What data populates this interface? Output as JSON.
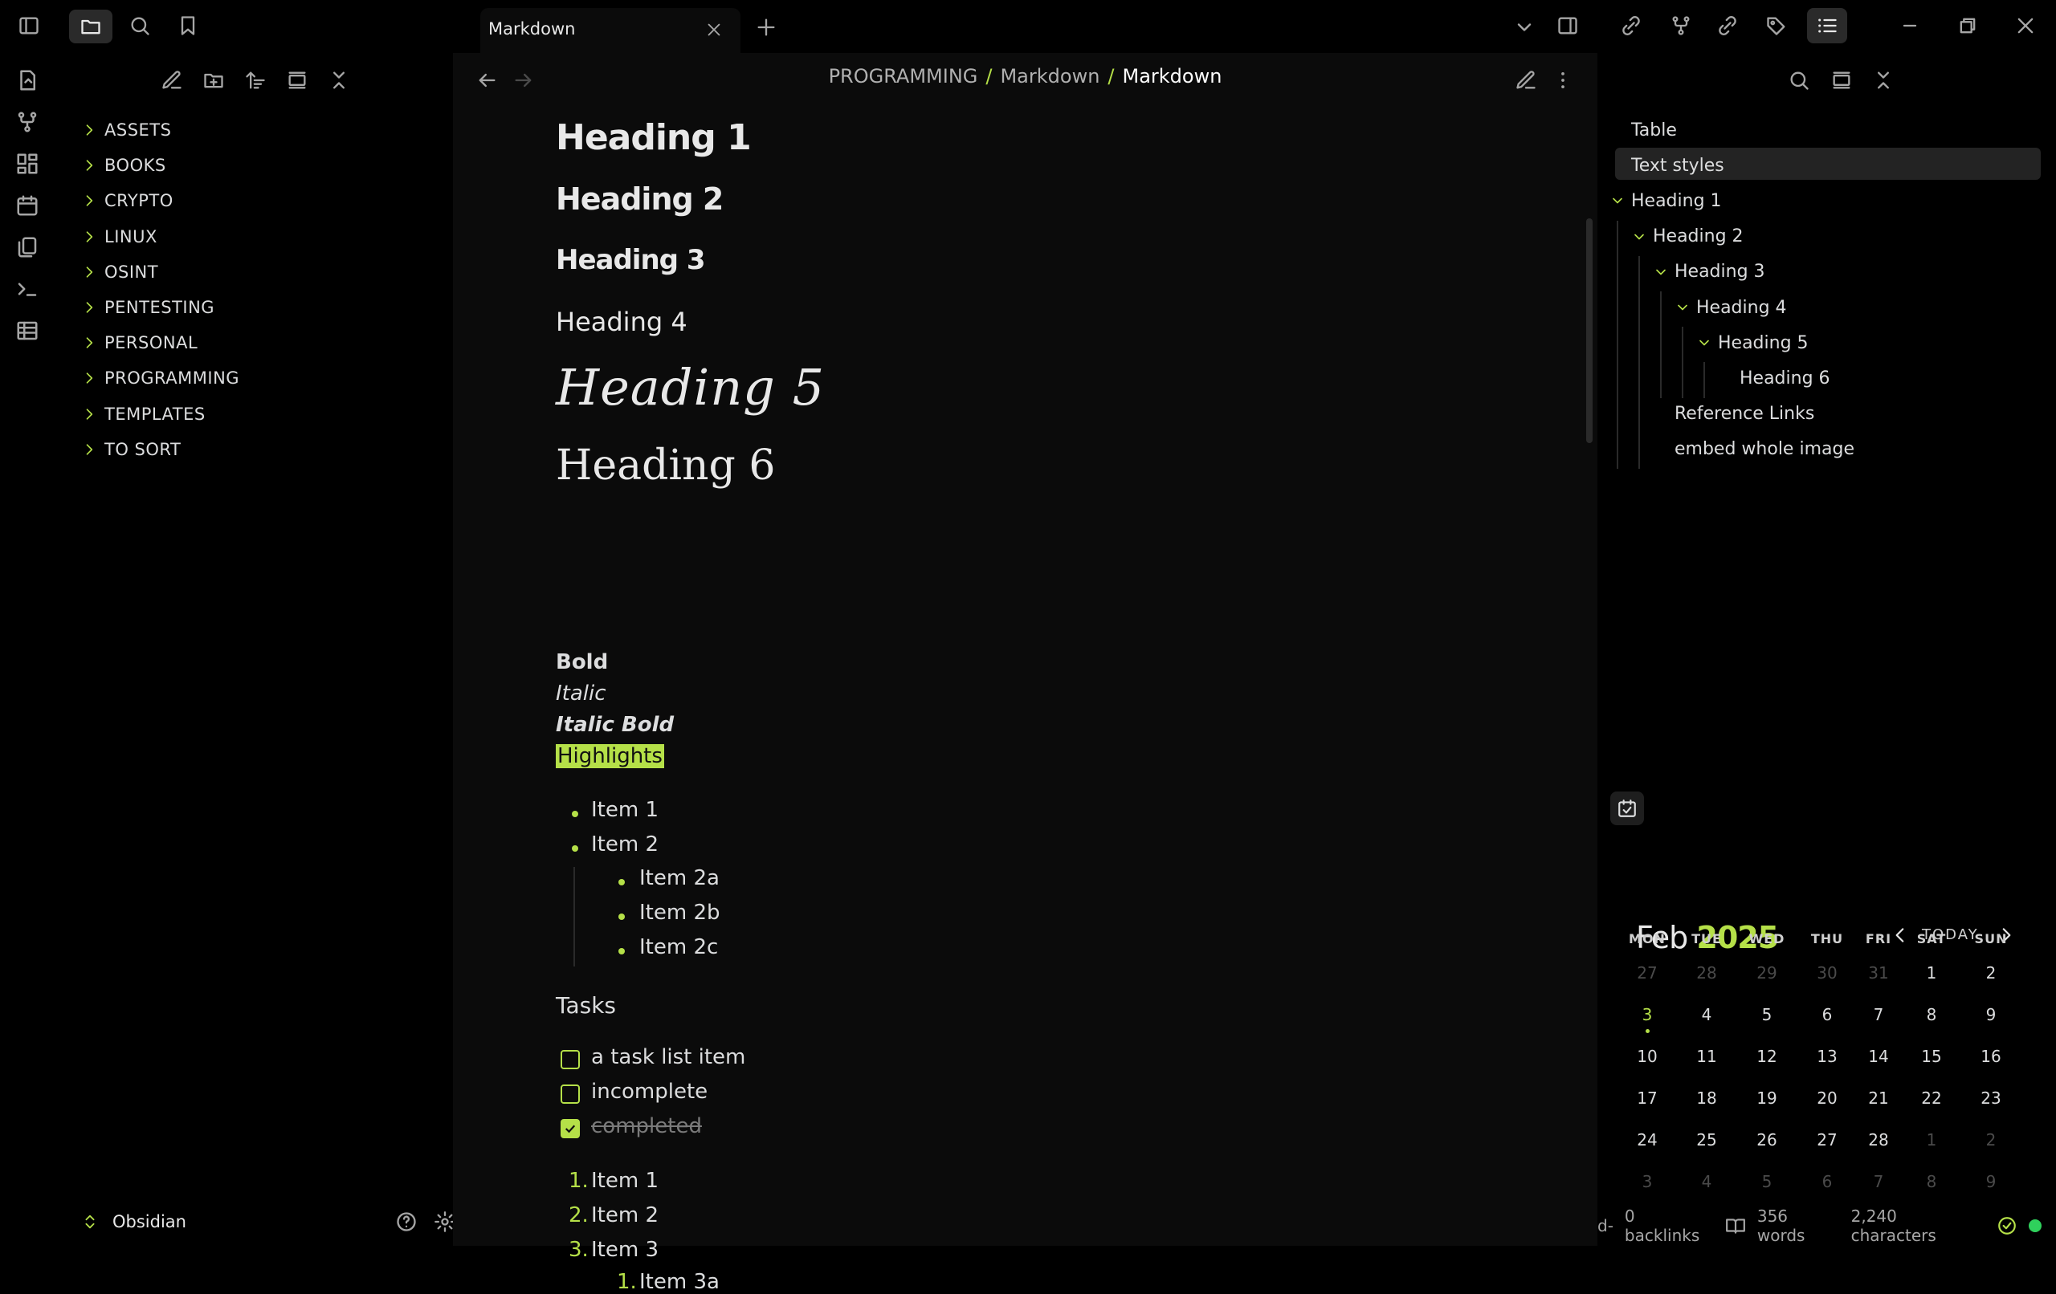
{
  "titlebar": {
    "tab_title": "Markdown",
    "new_tab_symbol": "+",
    "left_icons": [
      "sidebar-toggle-icon",
      "folder-icon",
      "search-icon",
      "bookmark-icon"
    ],
    "right_icons": [
      "chevron-down-icon",
      "right-sidebar-icon",
      "backlinks-icon",
      "graph-icon",
      "outgoing-links-icon",
      "tags-icon",
      "outline-icon",
      "minimize-icon",
      "restore-icon",
      "close-icon"
    ]
  },
  "ribbon": [
    "open-quick-switcher-icon",
    "graph-view-icon",
    "canvas-icon",
    "daily-note-icon",
    "templates-icon",
    "command-palette-icon",
    "table-icon"
  ],
  "files": {
    "toolbar_icons": [
      "new-note-icon",
      "new-folder-icon",
      "sort-icon",
      "collapse-all-icon",
      "close-pane-icon"
    ],
    "folders": [
      "ASSETS",
      "BOOKS",
      "CRYPTO",
      "LINUX",
      "OSINT",
      "PENTESTING",
      "PERSONAL",
      "PROGRAMMING",
      "TEMPLATES",
      "TO SORT"
    ],
    "vault_name": "Obsidian"
  },
  "editor": {
    "breadcrumb": [
      "PROGRAMMING",
      "Markdown",
      "Markdown"
    ],
    "sep": "/",
    "h1": "Heading 1",
    "h2": "Heading 2",
    "h3": "Heading 3",
    "h4": "Heading 4",
    "h5": "Heading 5",
    "h6": "Heading 6",
    "bold": "Bold",
    "italic": "Italic",
    "italic_bold": "Italic Bold",
    "highlight": "Highlights",
    "bullets": [
      "Item 1",
      "Item 2"
    ],
    "sub_bullets": [
      "Item 2a",
      "Item 2b",
      "Item 2c"
    ],
    "tasks_heading": "Tasks",
    "tasks": [
      {
        "label": "a task list item",
        "done": false
      },
      {
        "label": "incomplete",
        "done": false
      },
      {
        "label": "completed",
        "done": true
      }
    ],
    "ordered": [
      {
        "num": "1.",
        "label": "Item 1"
      },
      {
        "num": "2.",
        "label": "Item 2"
      },
      {
        "num": "3.",
        "label": "Item 3"
      }
    ],
    "ordered_sub": {
      "num": "1.",
      "label": "Item 3a"
    }
  },
  "outline": [
    {
      "label": "Table",
      "level": 0,
      "chev": false,
      "selected": false
    },
    {
      "label": "Text styles",
      "level": 0,
      "chev": false,
      "selected": true
    },
    {
      "label": "Heading 1",
      "level": 0,
      "chev": true,
      "selected": false
    },
    {
      "label": "Heading 2",
      "level": 1,
      "chev": true,
      "selected": false
    },
    {
      "label": "Heading 3",
      "level": 2,
      "chev": true,
      "selected": false
    },
    {
      "label": "Heading 4",
      "level": 3,
      "chev": true,
      "selected": false
    },
    {
      "label": "Heading 5",
      "level": 4,
      "chev": true,
      "selected": false
    },
    {
      "label": "Heading 6",
      "level": 5,
      "chev": false,
      "selected": false
    },
    {
      "label": "Reference Links",
      "level": 2,
      "chev": false,
      "selected": false
    },
    {
      "label": "embed whole image",
      "level": 2,
      "chev": false,
      "selected": false
    }
  ],
  "calendar": {
    "month": "Feb",
    "year": "2025",
    "today_label": "TODAY",
    "dow": [
      "MON",
      "TUE",
      "WED",
      "THU",
      "FRI",
      "SAT",
      "SUN"
    ],
    "weeks": [
      [
        [
          "27",
          1
        ],
        [
          "28",
          1
        ],
        [
          "29",
          1
        ],
        [
          "30",
          1
        ],
        [
          "31",
          1
        ],
        [
          "1",
          0
        ],
        [
          "2",
          0
        ]
      ],
      [
        [
          "3",
          2
        ],
        [
          "4",
          0
        ],
        [
          "5",
          0
        ],
        [
          "6",
          0
        ],
        [
          "7",
          0
        ],
        [
          "8",
          0
        ],
        [
          "9",
          0
        ]
      ],
      [
        [
          "10",
          0
        ],
        [
          "11",
          0
        ],
        [
          "12",
          0
        ],
        [
          "13",
          0
        ],
        [
          "14",
          0
        ],
        [
          "15",
          0
        ],
        [
          "16",
          0
        ]
      ],
      [
        [
          "17",
          0
        ],
        [
          "18",
          0
        ],
        [
          "19",
          0
        ],
        [
          "20",
          0
        ],
        [
          "21",
          0
        ],
        [
          "22",
          0
        ],
        [
          "23",
          0
        ]
      ],
      [
        [
          "24",
          0
        ],
        [
          "25",
          0
        ],
        [
          "26",
          0
        ],
        [
          "27",
          0
        ],
        [
          "28",
          0
        ],
        [
          "1",
          1
        ],
        [
          "2",
          1
        ]
      ],
      [
        [
          "3",
          1
        ],
        [
          "4",
          1
        ],
        [
          "5",
          1
        ],
        [
          "6",
          1
        ],
        [
          "7",
          1
        ],
        [
          "8",
          1
        ],
        [
          "9",
          1
        ]
      ]
    ]
  },
  "status": {
    "mode": "d-",
    "backlinks": "0 backlinks",
    "words": "356 words",
    "characters": "2,240 characters"
  },
  "colors": {
    "accent": "#b5e048",
    "bg": "#000000",
    "editor_bg": "#0b0b0b"
  }
}
